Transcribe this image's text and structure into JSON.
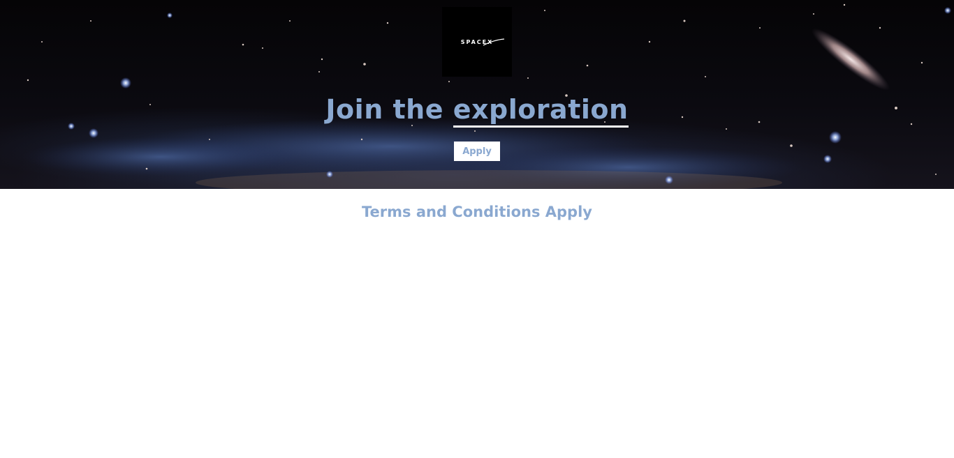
{
  "hero": {
    "logo": {
      "text": "SPACEX",
      "icon": "spacex-logo"
    },
    "headline_start": "Join the ",
    "headline_emphasis": "exploration",
    "apply_label": "Apply",
    "background": "starfield-galaxy-image"
  },
  "footer": {
    "terms_text": "Terms and Conditions Apply"
  },
  "colors": {
    "accent": "#8aa8d0",
    "hero_bg": "#0b0a10",
    "underline": "#ffffff"
  }
}
